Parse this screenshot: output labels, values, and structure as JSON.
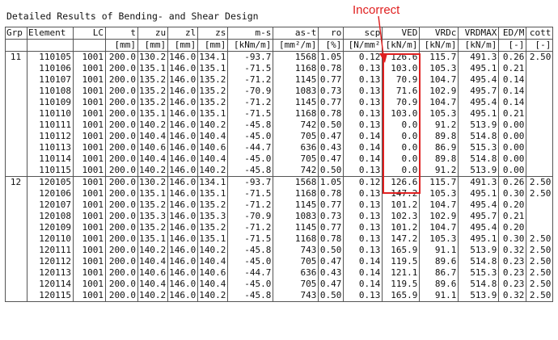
{
  "title": "Detailed Results of Bending- and Shear Design",
  "annotation": {
    "label": "Incorrect",
    "color": "#e02020"
  },
  "columns": [
    {
      "key": "grp",
      "header": "Grp",
      "unit": ""
    },
    {
      "key": "element",
      "header": "Element",
      "unit": ""
    },
    {
      "key": "lc",
      "header": "LC",
      "unit": ""
    },
    {
      "key": "t",
      "header": "t",
      "unit": "[mm]"
    },
    {
      "key": "zu",
      "header": "zu",
      "unit": "[mm]"
    },
    {
      "key": "zl",
      "header": "zl",
      "unit": "[mm]"
    },
    {
      "key": "zs",
      "header": "zs",
      "unit": "[mm]"
    },
    {
      "key": "ms",
      "header": "m-s",
      "unit": "[kNm/m]"
    },
    {
      "key": "ast",
      "header": "as-t",
      "unit": "[mm²/m]"
    },
    {
      "key": "ro",
      "header": "ro",
      "unit": "[%]"
    },
    {
      "key": "scp",
      "header": "scp",
      "unit": "[N/mm²"
    },
    {
      "key": "ved",
      "header": "VED",
      "unit": "[kN/m]"
    },
    {
      "key": "vrdc",
      "header": "VRDc",
      "unit": "[kN/m]"
    },
    {
      "key": "vrdmax",
      "header": "VRDMAX",
      "unit": "[kN/m]"
    },
    {
      "key": "edm",
      "header": "ED/M",
      "unit": "[-]"
    },
    {
      "key": "cott",
      "header": "cott",
      "unit": "[-]"
    }
  ],
  "groups": [
    {
      "grp": "11",
      "rows": [
        [
          "110105",
          "1001",
          "200.0",
          "130.2",
          "146.0",
          "134.1",
          "-93.7",
          "1568",
          "1.05",
          "0.12",
          "126.6",
          "115.7",
          "491.3",
          "0.26",
          "2.50"
        ],
        [
          "110106",
          "1001",
          "200.0",
          "135.1",
          "146.0",
          "135.1",
          "-71.5",
          "1168",
          "0.78",
          "0.13",
          "103.0",
          "105.3",
          "495.1",
          "0.21",
          ""
        ],
        [
          "110107",
          "1001",
          "200.0",
          "135.2",
          "146.0",
          "135.2",
          "-71.2",
          "1145",
          "0.77",
          "0.13",
          "70.9",
          "104.7",
          "495.4",
          "0.14",
          ""
        ],
        [
          "110108",
          "1001",
          "200.0",
          "135.2",
          "146.0",
          "135.2",
          "-70.9",
          "1083",
          "0.73",
          "0.13",
          "71.6",
          "102.9",
          "495.7",
          "0.14",
          ""
        ],
        [
          "110109",
          "1001",
          "200.0",
          "135.2",
          "146.0",
          "135.2",
          "-71.2",
          "1145",
          "0.77",
          "0.13",
          "70.9",
          "104.7",
          "495.4",
          "0.14",
          ""
        ],
        [
          "110110",
          "1001",
          "200.0",
          "135.1",
          "146.0",
          "135.1",
          "-71.5",
          "1168",
          "0.78",
          "0.13",
          "103.0",
          "105.3",
          "495.1",
          "0.21",
          ""
        ],
        [
          "110111",
          "1001",
          "200.0",
          "140.2",
          "146.0",
          "140.2",
          "-45.8",
          "742",
          "0.50",
          "0.13",
          "0.0",
          "91.2",
          "513.9",
          "0.00",
          ""
        ],
        [
          "110112",
          "1001",
          "200.0",
          "140.4",
          "146.0",
          "140.4",
          "-45.0",
          "705",
          "0.47",
          "0.14",
          "0.0",
          "89.8",
          "514.8",
          "0.00",
          ""
        ],
        [
          "110113",
          "1001",
          "200.0",
          "140.6",
          "146.0",
          "140.6",
          "-44.7",
          "636",
          "0.43",
          "0.14",
          "0.0",
          "86.9",
          "515.3",
          "0.00",
          ""
        ],
        [
          "110114",
          "1001",
          "200.0",
          "140.4",
          "146.0",
          "140.4",
          "-45.0",
          "705",
          "0.47",
          "0.14",
          "0.0",
          "89.8",
          "514.8",
          "0.00",
          ""
        ],
        [
          "110115",
          "1001",
          "200.0",
          "140.2",
          "146.0",
          "140.2",
          "-45.8",
          "742",
          "0.50",
          "0.13",
          "0.0",
          "91.2",
          "513.9",
          "0.00",
          ""
        ]
      ]
    },
    {
      "grp": "12",
      "rows": [
        [
          "120105",
          "1001",
          "200.0",
          "130.2",
          "146.0",
          "134.1",
          "-93.7",
          "1568",
          "1.05",
          "0.12",
          "126.6",
          "115.7",
          "491.3",
          "0.26",
          "2.50"
        ],
        [
          "120106",
          "1001",
          "200.0",
          "135.1",
          "146.0",
          "135.1",
          "-71.5",
          "1168",
          "0.78",
          "0.13",
          "147.2",
          "105.3",
          "495.1",
          "0.30",
          "2.50"
        ],
        [
          "120107",
          "1001",
          "200.0",
          "135.2",
          "146.0",
          "135.2",
          "-71.2",
          "1145",
          "0.77",
          "0.13",
          "101.2",
          "104.7",
          "495.4",
          "0.20",
          ""
        ],
        [
          "120108",
          "1001",
          "200.0",
          "135.3",
          "146.0",
          "135.3",
          "-70.9",
          "1083",
          "0.73",
          "0.13",
          "102.3",
          "102.9",
          "495.7",
          "0.21",
          ""
        ],
        [
          "120109",
          "1001",
          "200.0",
          "135.2",
          "146.0",
          "135.2",
          "-71.2",
          "1145",
          "0.77",
          "0.13",
          "101.2",
          "104.7",
          "495.4",
          "0.20",
          ""
        ],
        [
          "120110",
          "1001",
          "200.0",
          "135.1",
          "146.0",
          "135.1",
          "-71.5",
          "1168",
          "0.78",
          "0.13",
          "147.2",
          "105.3",
          "495.1",
          "0.30",
          "2.50"
        ],
        [
          "120111",
          "1001",
          "200.0",
          "140.2",
          "146.0",
          "140.2",
          "-45.8",
          "743",
          "0.50",
          "0.13",
          "165.9",
          "91.1",
          "513.9",
          "0.32",
          "2.50"
        ],
        [
          "120112",
          "1001",
          "200.0",
          "140.4",
          "146.0",
          "140.4",
          "-45.0",
          "705",
          "0.47",
          "0.14",
          "119.5",
          "89.6",
          "514.8",
          "0.23",
          "2.50"
        ],
        [
          "120113",
          "1001",
          "200.0",
          "140.6",
          "146.0",
          "140.6",
          "-44.7",
          "636",
          "0.43",
          "0.14",
          "121.1",
          "86.7",
          "515.3",
          "0.23",
          "2.50"
        ],
        [
          "120114",
          "1001",
          "200.0",
          "140.4",
          "146.0",
          "140.4",
          "-45.0",
          "705",
          "0.47",
          "0.14",
          "119.5",
          "89.6",
          "514.8",
          "0.23",
          "2.50"
        ],
        [
          "120115",
          "1001",
          "200.0",
          "140.2",
          "146.0",
          "140.2",
          "-45.8",
          "743",
          "0.50",
          "0.13",
          "165.9",
          "91.1",
          "513.9",
          "0.32",
          "2.50"
        ]
      ]
    }
  ]
}
